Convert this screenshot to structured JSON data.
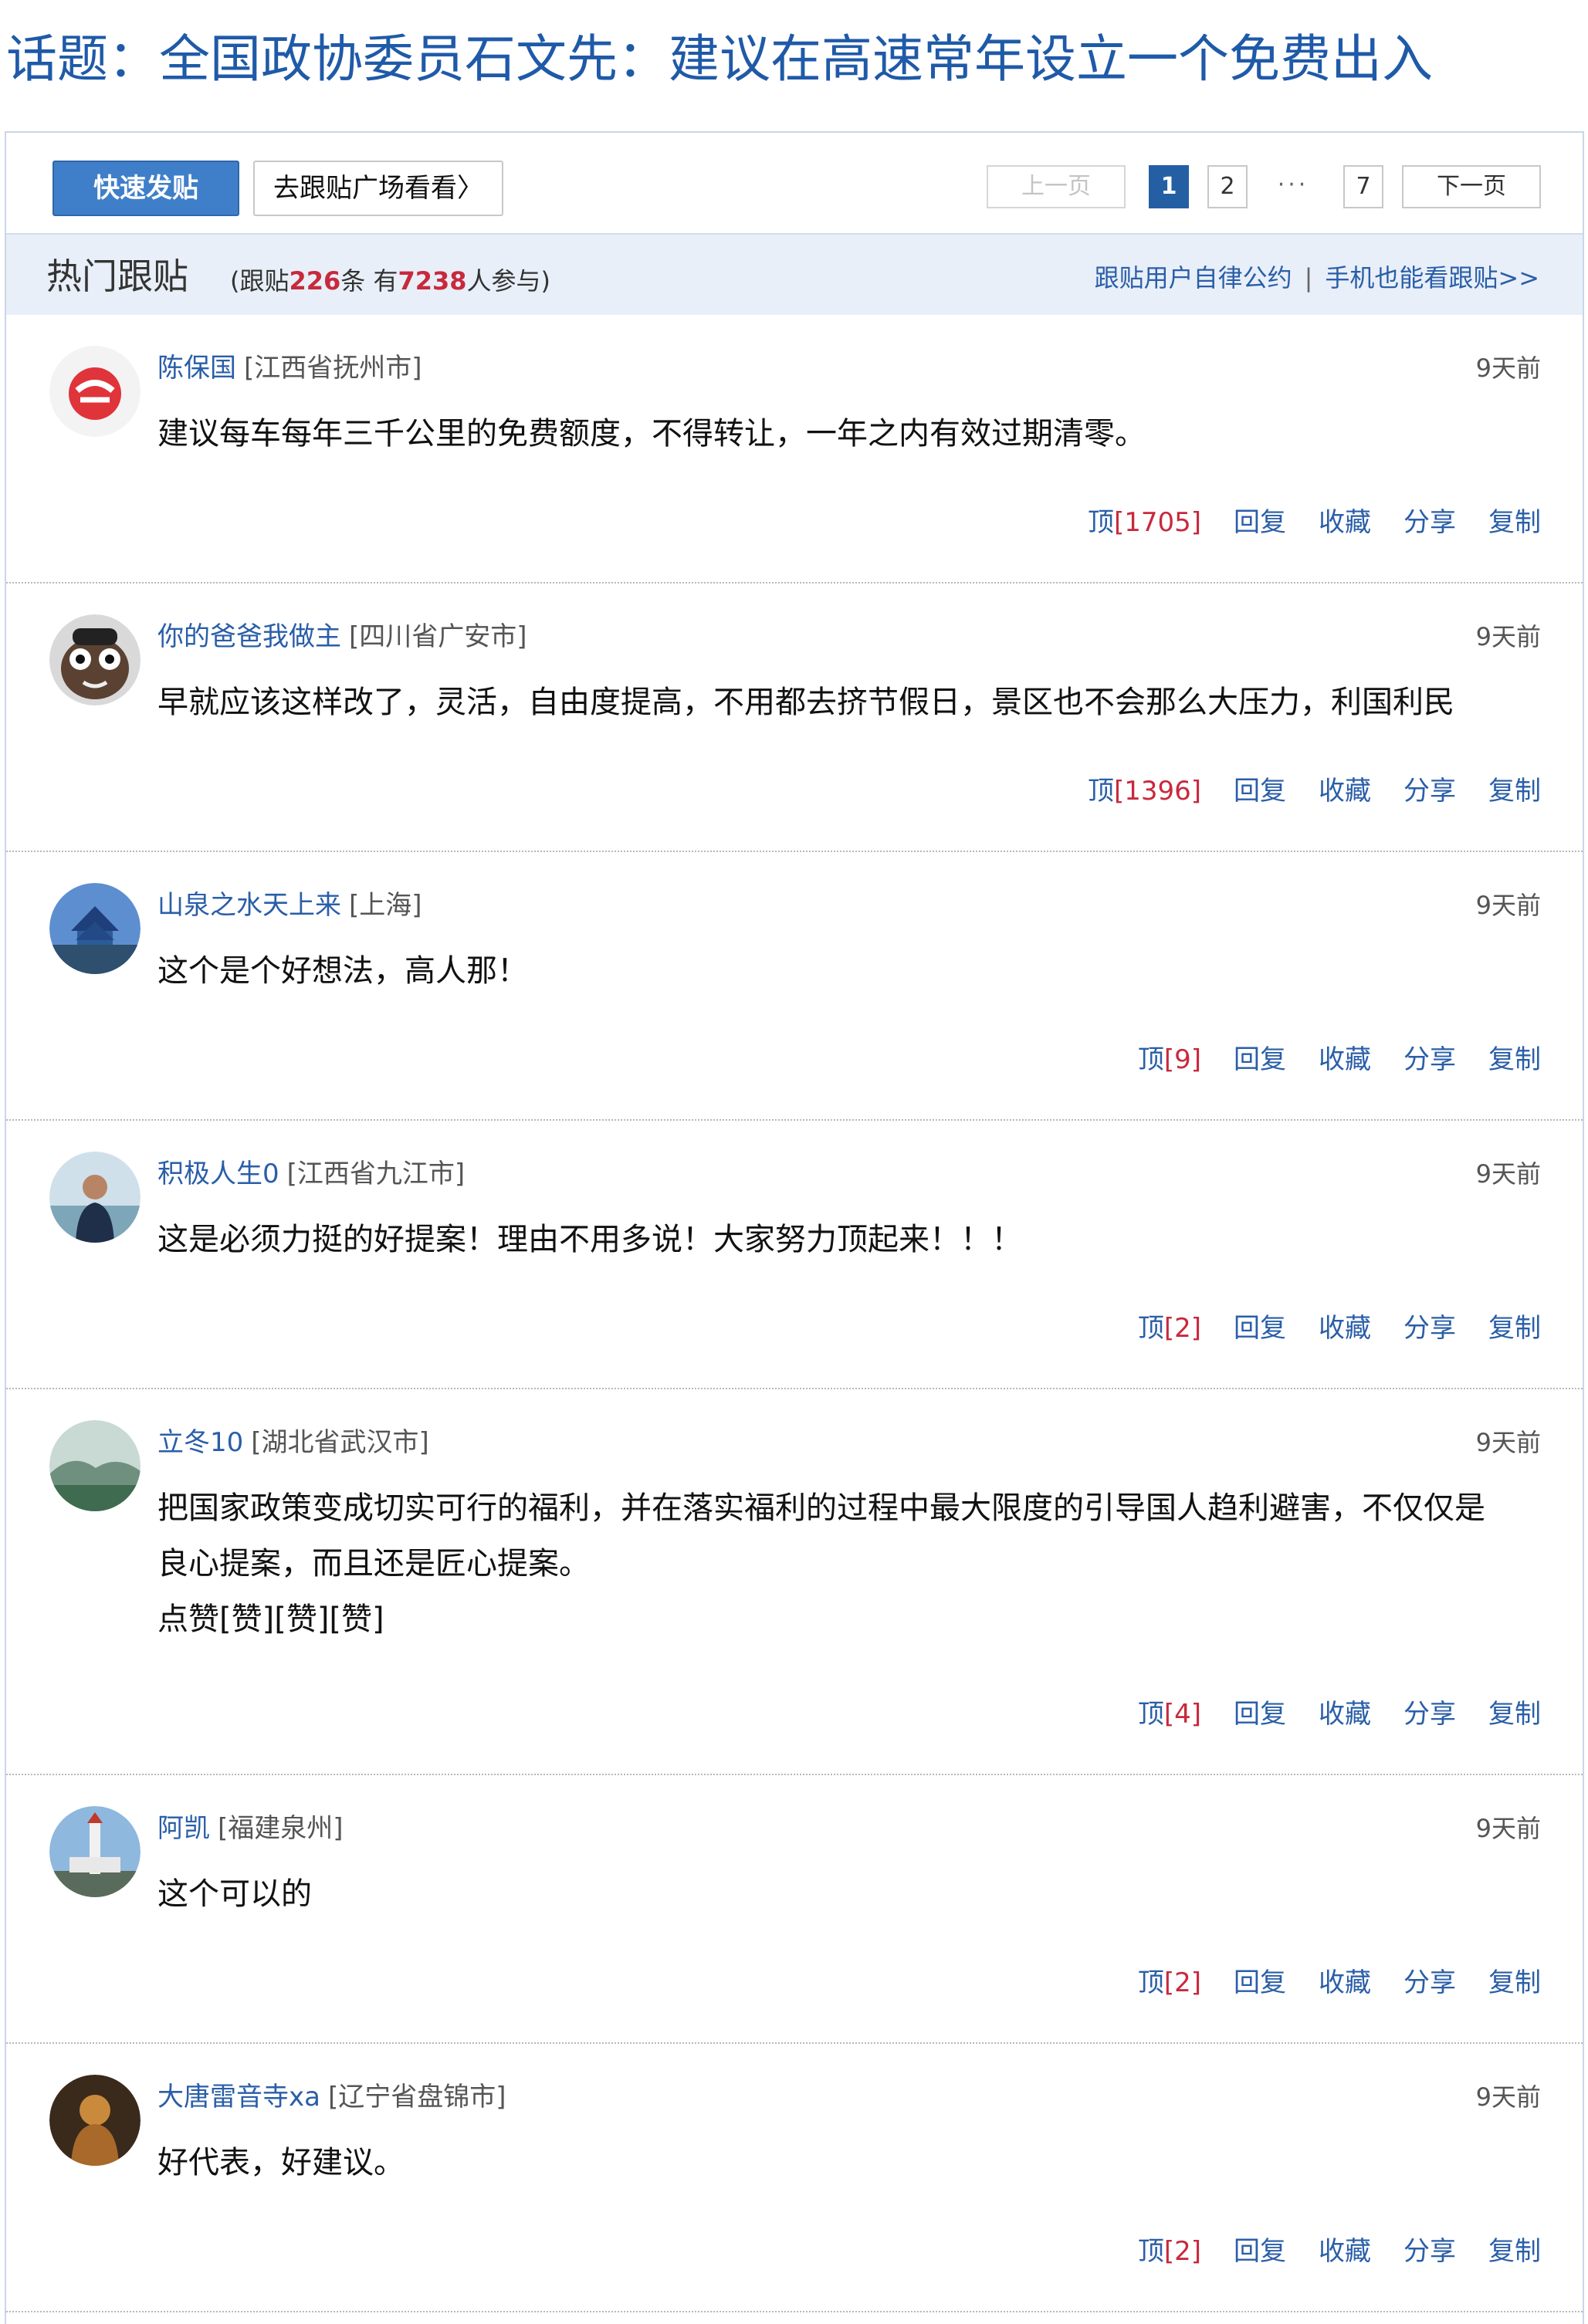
{
  "topic": {
    "title": "话题：全国政协委员石文先：建议在高速常年设立一个免费出入"
  },
  "toolbar": {
    "quick_post": "快速发贴",
    "plaza_link": "去跟贴广场看看",
    "plaza_arrow": "〉",
    "pager": {
      "prev": "上一页",
      "pages": [
        "1",
        "2"
      ],
      "dots": "···",
      "last": "7",
      "next": "下一页",
      "current": "1"
    }
  },
  "hot": {
    "title": "热门跟贴",
    "stats_prefix": "(跟贴",
    "reply_count": "226",
    "stats_mid": "条 有",
    "participant_count": "7238",
    "stats_suffix": "人参与)",
    "link_rules": "跟贴用户自律公约",
    "separator": "|",
    "link_mobile": "手机也能看跟贴",
    "link_mobile_arrow": ">>"
  },
  "action_labels": {
    "vote_prefix": "顶",
    "reply": "回复",
    "collect": "收藏",
    "share": "分享",
    "copy": "复制"
  },
  "comments": [
    {
      "user": "陈保国",
      "location": "[江西省抚州市]",
      "time": "9天前",
      "lines": [
        "建议每车每年三千公里的免费额度，不得转让，一年之内有效过期清零。"
      ],
      "votes": "[1705]",
      "avatar": "netease-logo-avatar"
    },
    {
      "user": "你的爸爸我做主",
      "location": "[四川省广安市]",
      "time": "9天前",
      "lines": [
        "早就应该这样改了，灵活，自由度提高，不用都去挤节假日，景区也不会那么大压力，利国利民"
      ],
      "votes": "[1396]",
      "avatar": "cartoon-avatar"
    },
    {
      "user": "山泉之水天上来",
      "location": "[上海]",
      "time": "9天前",
      "lines": [
        "这个是个好想法，高人那！"
      ],
      "votes": "[9]",
      "avatar": "temple-avatar"
    },
    {
      "user": "积极人生0",
      "location": "[江西省九江市]",
      "time": "9天前",
      "lines": [
        "这是必须力挺的好提案！理由不用多说！大家努力顶起来！！！"
      ],
      "votes": "[2]",
      "avatar": "person-photo-avatar"
    },
    {
      "user": "立冬10",
      "location": "[湖北省武汉市]",
      "time": "9天前",
      "lines": [
        "把国家政策变成切实可行的福利，并在落实福利的过程中最大限度的引导国人趋利避害，不仅仅是",
        "良心提案，而且还是匠心提案。",
        "点赞[赞][赞][赞]"
      ],
      "votes": "[4]",
      "avatar": "landscape-avatar"
    },
    {
      "user": "阿凯",
      "location": "[福建泉州]",
      "time": "9天前",
      "lines": [
        "这个可以的"
      ],
      "votes": "[2]",
      "avatar": "tower-avatar"
    },
    {
      "user": "大唐雷音寺xa",
      "location": "[辽宁省盘锦市]",
      "time": "9天前",
      "lines": [
        "好代表，好建议。"
      ],
      "votes": "[2]",
      "avatar": "buddha-avatar"
    }
  ],
  "colors": {
    "link": "#2a5ea8",
    "count_red": "#c8293c",
    "quick_post_bg": "#3f7fc9",
    "active_page": "#245fa4",
    "hot_bar_bg": "#e8eff8"
  }
}
